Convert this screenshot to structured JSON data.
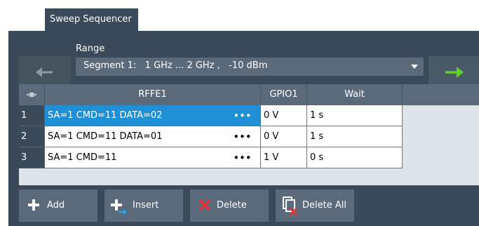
{
  "tab": {
    "label": "Sweep Sequencer"
  },
  "range": {
    "label": "Range",
    "value": "Segment 1:   1 GHz ... 2 GHz ,   -10 dBm"
  },
  "table": {
    "headers": {
      "index_icon": "◂■▸",
      "rffe": "RFFE1",
      "gpio": "GPIO1",
      "wait": "Wait"
    },
    "rows": [
      {
        "index": "1",
        "rffe": "SA=1 CMD=11 DATA=02",
        "gpio": "0 V",
        "wait": "1 s",
        "selected": true
      },
      {
        "index": "2",
        "rffe": "SA=1 CMD=11 DATA=01",
        "gpio": "0 V",
        "wait": "1 s",
        "selected": false
      },
      {
        "index": "3",
        "rffe": "SA=1 CMD=11",
        "gpio": "1 V",
        "wait": "0 s",
        "selected": false
      }
    ],
    "ellipsis": "•••"
  },
  "toolbar": {
    "add": "Add",
    "insert": "Insert",
    "delete": "Delete",
    "delete_all": "Delete All"
  },
  "colors": {
    "panel": "#3a4a5a",
    "accent_green": "#5fd12a",
    "selection_blue": "#1f8fd6",
    "delete_red": "#e8303a"
  }
}
